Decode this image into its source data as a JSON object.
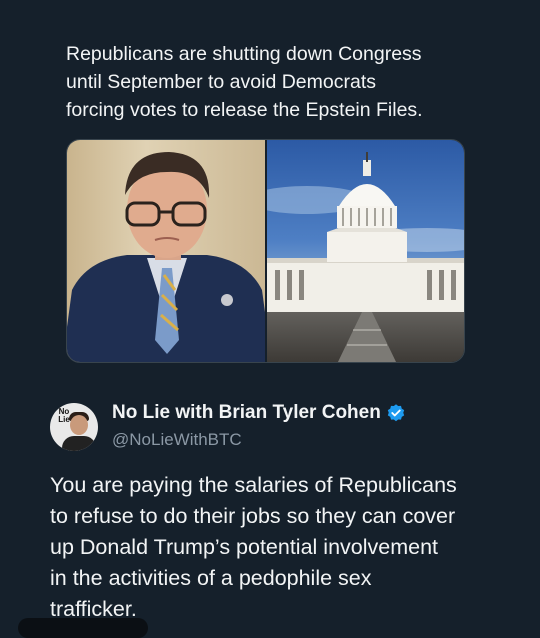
{
  "quoted_post": {
    "text": "Republicans are shutting down Congress\nuntil September to avoid Democrats\nforcing votes to release the Epstein Files."
  },
  "post": {
    "author_name": "No Lie with Brian Tyler Cohen",
    "handle": "@NoLieWithBTC",
    "avatar_logo": "No\nLie",
    "text": "You are paying the salaries of Republicans\nto refuse to do their jobs so they can cover\nup Donald Trump’s potential involvement\nin the activities of a pedophile sex\ntrafficker."
  },
  "colors": {
    "background": "#15202b",
    "text": "#e7e9ea",
    "secondary_text": "#8b98a5",
    "verified_badge": "#1d9bf0"
  },
  "icons": {
    "verified": "verified-badge-icon"
  }
}
